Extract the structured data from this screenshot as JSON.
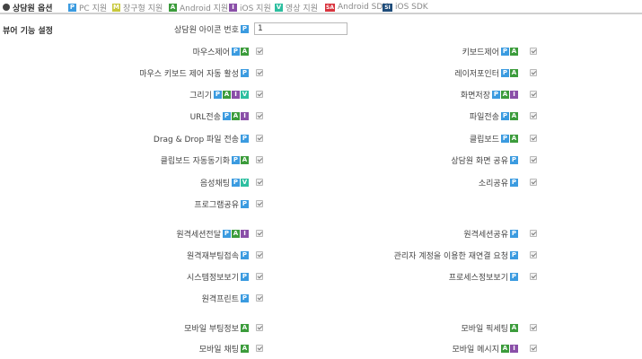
{
  "header": {
    "title": "상담원 옵션",
    "legend": [
      {
        "badge": "P",
        "badge_class": "b-p",
        "label": "PC 지원"
      },
      {
        "badge": "M",
        "badge_class": "b-mob",
        "label": "장구형 지원"
      },
      {
        "badge": "A",
        "badge_class": "b-a",
        "label": "Android 지원"
      },
      {
        "badge": "I",
        "badge_class": "b-i",
        "label": "iOS 지원"
      },
      {
        "badge": "V",
        "badge_class": "b-v",
        "label": "영상 지원"
      },
      {
        "badge": "SA",
        "badge_class": "b-sa",
        "label": "Android SDK"
      },
      {
        "badge": "SI",
        "badge_class": "b-si",
        "label": "iOS SDK"
      }
    ]
  },
  "section": {
    "title": "뷰어 기능 설정",
    "icon_number_label": "상담원 아이콘 번호",
    "icon_number_value": "1"
  },
  "left_options": [
    {
      "label": "마우스제어",
      "badges": [
        "P",
        "A"
      ],
      "checked": true
    },
    {
      "label": "마우스 키보드 제어 자동 활성",
      "badges": [
        "P"
      ],
      "checked": true
    },
    {
      "label": "그리기",
      "badges": [
        "P",
        "A",
        "I",
        "V"
      ],
      "checked": true
    },
    {
      "label": "URL전송",
      "badges": [
        "P",
        "A",
        "I"
      ],
      "checked": true
    },
    {
      "label": "Drag & Drop 파일 전송",
      "badges": [
        "P"
      ],
      "checked": true
    },
    {
      "label": "클립보드 자동동기화",
      "badges": [
        "P",
        "A"
      ],
      "checked": true
    },
    {
      "label": "음성채팅",
      "badges": [
        "P",
        "V"
      ],
      "checked": true
    },
    {
      "label": "프로그램공유",
      "badges": [
        "P"
      ],
      "checked": true
    },
    {
      "label": "원격세션전달",
      "badges": [
        "P",
        "A",
        "I"
      ],
      "checked": true
    },
    {
      "label": "원격재부팅접속",
      "badges": [
        "P"
      ],
      "checked": true
    },
    {
      "label": "시스템정보보기",
      "badges": [
        "P"
      ],
      "checked": true
    },
    {
      "label": "원격프린트",
      "badges": [
        "P"
      ],
      "checked": true
    },
    {
      "label": "모바일 부팅정보",
      "badges": [
        "A"
      ],
      "checked": true
    },
    {
      "label": "모바일 채팅",
      "badges": [
        "A"
      ],
      "checked": true
    }
  ],
  "right_options": [
    {
      "label": "키보드제어",
      "badges": [
        "P",
        "A"
      ],
      "checked": true
    },
    {
      "label": "레이저포인터",
      "badges": [
        "P",
        "A"
      ],
      "checked": true
    },
    {
      "label": "화면저장",
      "badges": [
        "P",
        "A",
        "I"
      ],
      "checked": true
    },
    {
      "label": "파일전송",
      "badges": [
        "P",
        "A"
      ],
      "checked": true
    },
    {
      "label": "클립보드",
      "badges": [
        "P",
        "A"
      ],
      "checked": true
    },
    {
      "label": "상담원 화면 공유",
      "badges": [
        "P"
      ],
      "checked": true
    },
    {
      "label": "소리공유",
      "badges": [
        "P"
      ],
      "checked": true
    },
    {
      "label": "원격세션공유",
      "badges": [
        "P"
      ],
      "checked": true
    },
    {
      "label": "관리자 계정을 이용한 재연결 요청",
      "badges": [
        "P"
      ],
      "checked": true
    },
    {
      "label": "프로세스정보보기",
      "badges": [
        "P"
      ],
      "checked": true
    },
    {
      "label": "모바일 픽세팅",
      "badges": [
        "A"
      ],
      "checked": true
    },
    {
      "label": "모바일 메시지",
      "badges": [
        "A",
        "I"
      ],
      "checked": true
    }
  ]
}
